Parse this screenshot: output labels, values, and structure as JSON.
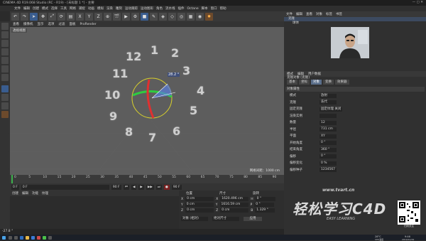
{
  "window": {
    "title": "CINEMA 4D R19.068 Studio (RC - R19) - [未标题 1 *] - 主要",
    "viewport_label": "透视视图"
  },
  "menubar": [
    "文件",
    "编辑",
    "创建",
    "模式",
    "选择",
    "工具",
    "网格",
    "捕捉",
    "动画",
    "模拟",
    "渲染",
    "雕刻",
    "运动跟踪",
    "运动图形",
    "角色",
    "流水线",
    "插件",
    "Octane",
    "脚本",
    "窗口",
    "帮助"
  ],
  "viewport_menu": [
    "查看",
    "摄像机",
    "显示",
    "选项",
    "过滤",
    "面板",
    "ProRender"
  ],
  "viewport": {
    "clock_numbers": [
      "12",
      "1",
      "2",
      "3",
      "4",
      "5",
      "6",
      "7",
      "8",
      "9",
      "10",
      "11"
    ],
    "angle_readout": "28.2 °",
    "grid_distance": "网格间距：1000 cm"
  },
  "timeline": {
    "ticks": [
      "0",
      "5",
      "10",
      "15",
      "20",
      "25",
      "30",
      "35",
      "40",
      "45",
      "50",
      "55",
      "60",
      "65",
      "70",
      "75",
      "80",
      "85",
      "90"
    ],
    "current_frame": "0 F",
    "start_frame": "0 F",
    "end_frame": "90 F",
    "end_frame_right": "90 F"
  },
  "material_manager_menu": [
    "创建",
    "编辑",
    "功能",
    "纹理"
  ],
  "coordinates": {
    "headers": [
      "位置",
      "尺寸",
      "旋转"
    ],
    "rows": [
      {
        "axis_p": "X",
        "pos": "0 cm",
        "size_axis": "X",
        "size": "1620.496 cm",
        "rot_axis": "H",
        "rot": "0 °"
      },
      {
        "axis_p": "Y",
        "pos": "0 cm",
        "size_axis": "Y",
        "size": "1616.59 cm",
        "rot_axis": "P",
        "rot": "0 °"
      },
      {
        "axis_p": "Z",
        "pos": "0 cm",
        "size_axis": "Z",
        "size": "0 cm",
        "rot_axis": "B",
        "rot": "1.329 °"
      }
    ],
    "mode": "对象 (相对)",
    "size_mode": "绝对尺寸",
    "apply": "应用"
  },
  "object_manager": {
    "menu": [
      "文件",
      "编辑",
      "查看",
      "对象",
      "标签",
      "书签"
    ],
    "objects": [
      "克隆",
      "球体"
    ]
  },
  "attribute_manager": {
    "menu": [
      "模式",
      "编辑",
      "用户数据"
    ],
    "object_title": "克隆对象 [克隆]",
    "tabs": [
      "基本",
      "坐标",
      "对象",
      "变换",
      "效果器"
    ],
    "active_tab": "对象",
    "section": "对象属性",
    "rows": [
      {
        "label": "模式",
        "value": "放射"
      },
      {
        "label": "克隆",
        "value": "迭代"
      },
      {
        "label": "固定克隆",
        "value": "固定纹理 关闭"
      },
      {
        "label": "渲染实例",
        "value": ""
      },
      {
        "label": "数量",
        "value": "12"
      },
      {
        "label": "半径",
        "value": "731 cm"
      },
      {
        "label": "平面",
        "value": "XY"
      },
      {
        "label": "开始角度",
        "value": "0 °"
      },
      {
        "label": "结束角度",
        "value": "360 °"
      },
      {
        "label": "偏移",
        "value": "0 °"
      },
      {
        "label": "偏移变化",
        "value": "0 %"
      },
      {
        "label": "偏移种子",
        "value": "1234567"
      }
    ]
  },
  "status_bar": "-27.8 °",
  "watermark": {
    "text": "轻松学习C4D",
    "url": "www.tvart.cn",
    "sub": "EASY LEARNING",
    "qr_label": "扫码关注"
  },
  "taskbar": {
    "time": "9:46",
    "date": "2019/12/29",
    "temp": "28°C",
    "cpu": "CPU温度"
  },
  "colors": {
    "viewport_bg": "#5d5d5d",
    "ring_green": "#2ecc40",
    "ring_red": "#e03030",
    "ring_yellow": "#e0c030",
    "angle_blue": "#5a7fe0"
  }
}
